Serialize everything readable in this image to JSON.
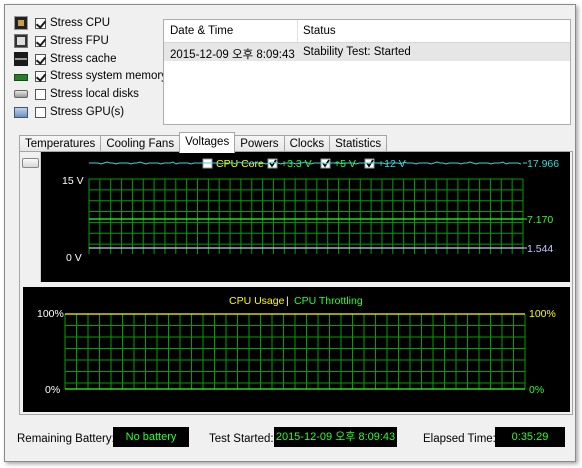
{
  "stress_options": [
    {
      "label": "Stress CPU",
      "checked": true,
      "icon": "cpu-icon"
    },
    {
      "label": "Stress FPU",
      "checked": true,
      "icon": "fpu-icon"
    },
    {
      "label": "Stress cache",
      "checked": true,
      "icon": "cache-icon"
    },
    {
      "label": "Stress system memory",
      "checked": true,
      "icon": "memory-icon"
    },
    {
      "label": "Stress local disks",
      "checked": false,
      "icon": "disk-icon"
    },
    {
      "label": "Stress GPU(s)",
      "checked": false,
      "icon": "gpu-icon"
    }
  ],
  "status_table": {
    "columns": [
      "Date & Time",
      "Status"
    ],
    "rows": [
      {
        "datetime": "2015-12-09 오후 8:09:43",
        "status": "Stability Test: Started"
      }
    ]
  },
  "tabs": [
    {
      "label": "Temperatures",
      "active": false
    },
    {
      "label": "Cooling Fans",
      "active": false
    },
    {
      "label": "Voltages",
      "active": true
    },
    {
      "label": "Powers",
      "active": false
    },
    {
      "label": "Clocks",
      "active": false
    },
    {
      "label": "Statistics",
      "active": false
    }
  ],
  "voltage_chart": {
    "legend": [
      {
        "label": "CPU Core",
        "color": "#ffff00",
        "checked": false
      },
      {
        "label": "+3.3 V",
        "color": "#2bff2b",
        "checked": true
      },
      {
        "label": "+5 V",
        "color": "#2bff2b",
        "checked": true
      },
      {
        "label": "+12 V",
        "color": "#3ad6d6",
        "checked": true
      }
    ],
    "y_top_label": "15 V",
    "y_bottom_label": "0 V",
    "right_values": [
      "17.966",
      "7.170",
      "1.544"
    ],
    "colors": {
      "grid": "#00a000",
      "v12": "#3ad6d6",
      "v5": "#2bff2b",
      "vcore": "#c8c8ff"
    }
  },
  "usage_chart": {
    "legend_left": "CPU Usage",
    "legend_sep": "|",
    "legend_right": "CPU Throttling",
    "left_top": "100%",
    "left_bottom": "0%",
    "right_top": "100%",
    "right_bottom": "0%",
    "colors": {
      "usage": "#ffff00",
      "throttling": "#2bff2b",
      "grid": "#00a000"
    }
  },
  "footer": {
    "battery_label": "Remaining Battery:",
    "battery_value": "No battery",
    "test_started_label": "Test Started:",
    "test_started_value": "2015-12-09 오후 8:09:43",
    "elapsed_label": "Elapsed Time:",
    "elapsed_value": "0:35:29"
  }
}
